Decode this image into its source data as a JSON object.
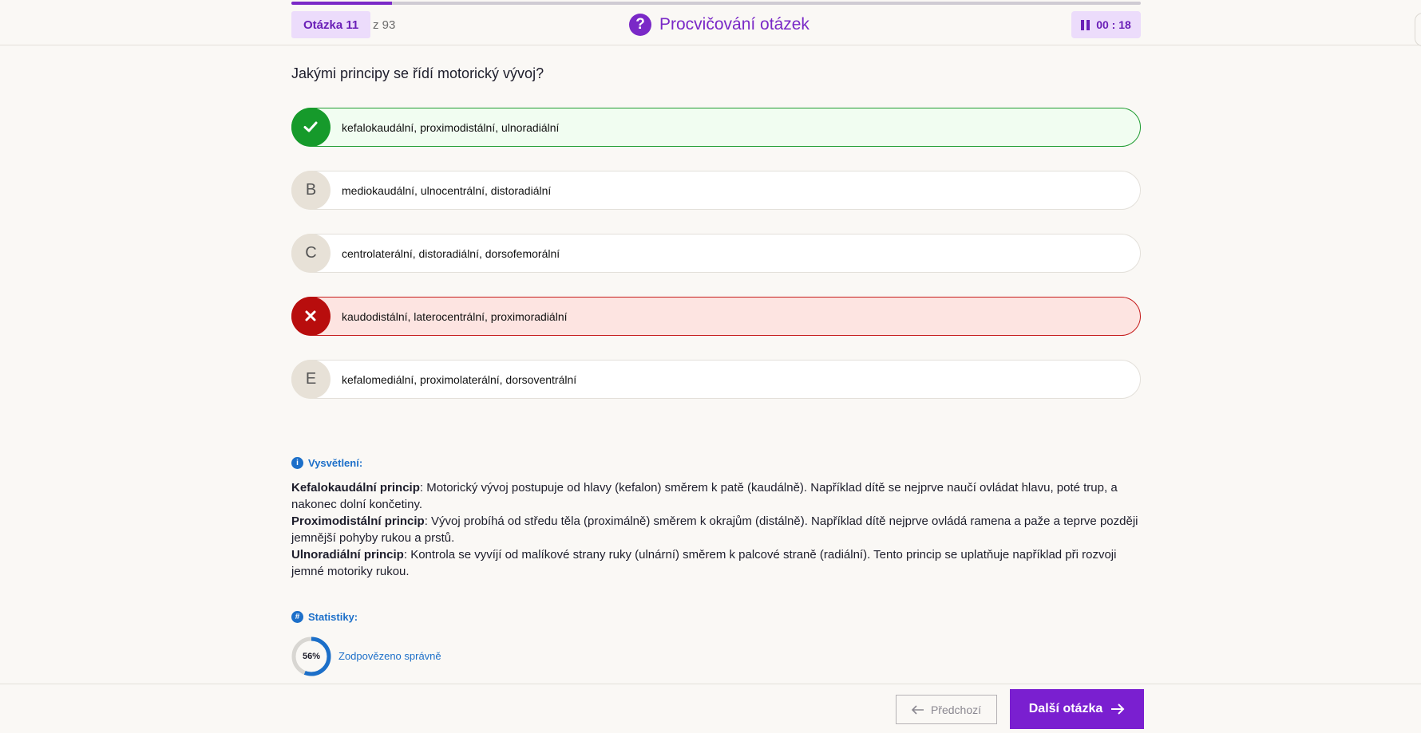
{
  "header": {
    "progress_fraction": 0.118,
    "question_label": "Otázka 11",
    "question_total": "z 93",
    "title": "Procvičování otázek",
    "timer": "00 : 18",
    "colors": {
      "accent": "#7a29c7",
      "badge_bg": "#ecdcfb"
    }
  },
  "question": "Jakými principy se řídí motorický vývoj?",
  "options": [
    {
      "marker": "",
      "icon": "check-icon",
      "state": "correct",
      "text": "kefalokaudální, proximodistální, ulnoradiální"
    },
    {
      "marker": "B",
      "state": "neutral",
      "text": "mediokaudální, ulnocentrální, distoradiální"
    },
    {
      "marker": "C",
      "state": "neutral",
      "text": "centrolaterální, distoradiální, dorsofemorální"
    },
    {
      "marker": "",
      "icon": "cross-icon",
      "state": "wrong",
      "text": "kaudodistální, laterocentrální, proximoradiální"
    },
    {
      "marker": "E",
      "state": "neutral",
      "text": "kefalomediální, proximolaterální, dorsoventrální"
    }
  ],
  "explanation": {
    "heading": "Vysvětlení:",
    "paragraphs": [
      {
        "term": "Kefalokaudální princip",
        "text": ": Motorický vývoj postupuje od hlavy (kefalon) směrem k patě (kaudálně). Například dítě se nejprve naučí ovládat hlavu, poté trup, a nakonec dolní končetiny."
      },
      {
        "term": "Proximodistální princip",
        "text": ": Vývoj probíhá od středu těla (proximálně) směrem k okrajům (distálně). Například dítě nejprve ovládá ramena a paže a teprve později jemnější pohyby rukou a prstů."
      },
      {
        "term": "Ulnoradiální princip",
        "text": ": Kontrola se vyvíjí od malíkové strany ruky (ulnární) směrem k palcové straně (radiální). Tento princip se uplatňuje například při rozvoji jemné motoriky rukou."
      }
    ]
  },
  "statistics": {
    "heading": "Statistiky:",
    "percent_correct": 56,
    "percent_label": "56%",
    "label": "Zodpovězeno správně"
  },
  "footer": {
    "prev_label": "Předchozí",
    "next_label": "Další otázka"
  }
}
